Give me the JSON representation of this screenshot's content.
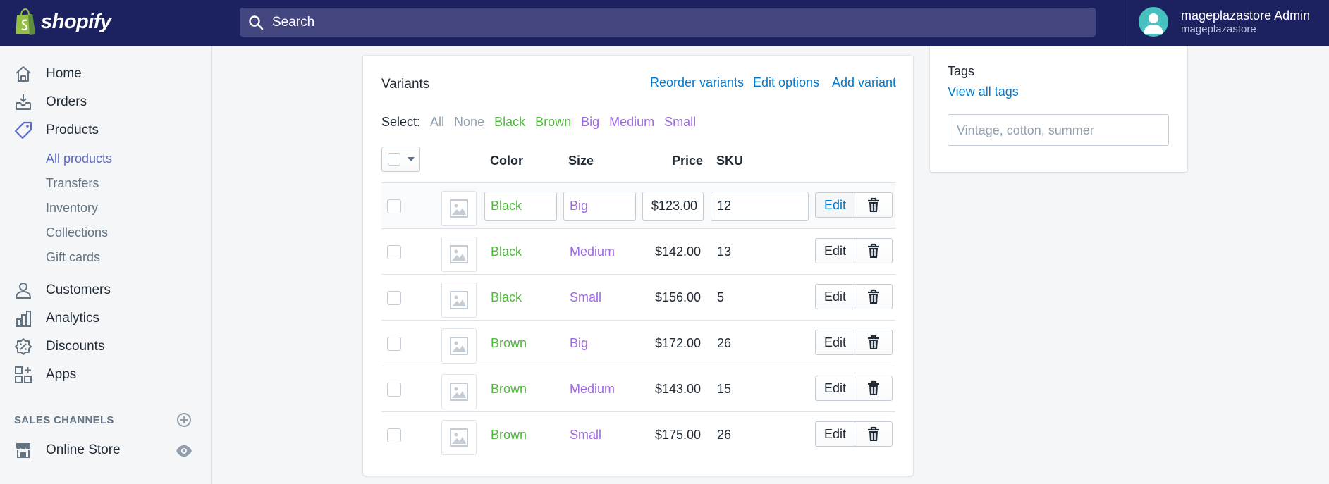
{
  "app": {
    "brand": "shopify",
    "search_placeholder": "Search",
    "user_name": "mageplazastore Admin",
    "user_store": "mageplazastore"
  },
  "sidebar": {
    "items": [
      {
        "label": "Home",
        "icon": "home-icon"
      },
      {
        "label": "Orders",
        "icon": "orders-icon"
      },
      {
        "label": "Products",
        "icon": "tag-icon"
      }
    ],
    "sub_items": [
      "All products",
      "Transfers",
      "Inventory",
      "Collections",
      "Gift cards"
    ],
    "items2": [
      {
        "label": "Customers",
        "icon": "person-icon"
      },
      {
        "label": "Analytics",
        "icon": "bar-chart-icon"
      },
      {
        "label": "Discounts",
        "icon": "discount-icon"
      },
      {
        "label": "Apps",
        "icon": "apps-icon"
      }
    ],
    "sales_channels_title": "SALES CHANNELS",
    "online_store": "Online Store"
  },
  "variants": {
    "title": "Variants",
    "actions": {
      "reorder": "Reorder variants",
      "edit_options": "Edit options",
      "add": "Add variant"
    },
    "select": {
      "label": "Select:",
      "all": "All",
      "none": "None",
      "black": "Black",
      "brown": "Brown",
      "big": "Big",
      "medium": "Medium",
      "small": "Small"
    },
    "columns": {
      "color": "Color",
      "size": "Size",
      "price": "Price",
      "sku": "SKU"
    },
    "edit_label": "Edit",
    "rows": [
      {
        "color": "Black",
        "size": "Big",
        "price": "$123.00",
        "sku": "12"
      },
      {
        "color": "Black",
        "size": "Medium",
        "price": "$142.00",
        "sku": "13"
      },
      {
        "color": "Black",
        "size": "Small",
        "price": "$156.00",
        "sku": "5"
      },
      {
        "color": "Brown",
        "size": "Big",
        "price": "$172.00",
        "sku": "26"
      },
      {
        "color": "Brown",
        "size": "Medium",
        "price": "$143.00",
        "sku": "15"
      },
      {
        "color": "Brown",
        "size": "Small",
        "price": "$175.00",
        "sku": "26"
      }
    ]
  },
  "tags": {
    "title": "Tags",
    "view_all": "View all tags",
    "placeholder": "Vintage, cotton, summer"
  },
  "colors": {
    "topbar": "#1c2260",
    "link": "#007ace",
    "active_nav": "#5c6ac4",
    "color_option": "#50b83c",
    "size_option": "#9c6ade"
  }
}
